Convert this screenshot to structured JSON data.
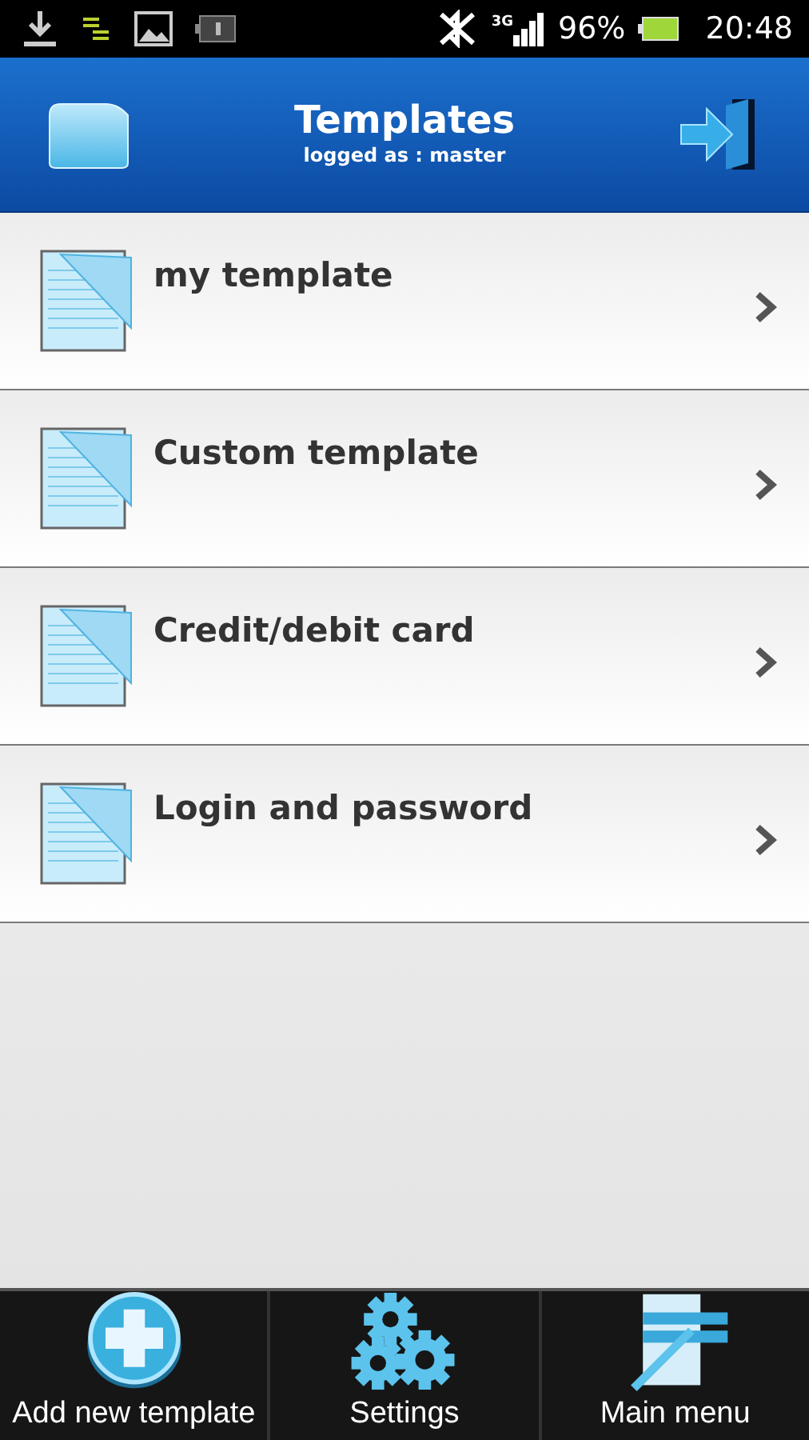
{
  "status_bar": {
    "battery": "96%",
    "time": "20:48",
    "network": "3G"
  },
  "header": {
    "title": "Templates",
    "subtitle": "logged as : master"
  },
  "templates": [
    {
      "label": "my template"
    },
    {
      "label": "Custom template"
    },
    {
      "label": "Credit/debit card"
    },
    {
      "label": "Login and password"
    }
  ],
  "bottom_bar": [
    {
      "kind": "add",
      "label": "Add new template"
    },
    {
      "kind": "settings",
      "label": "Settings"
    },
    {
      "kind": "menu",
      "label": "Main menu"
    }
  ]
}
